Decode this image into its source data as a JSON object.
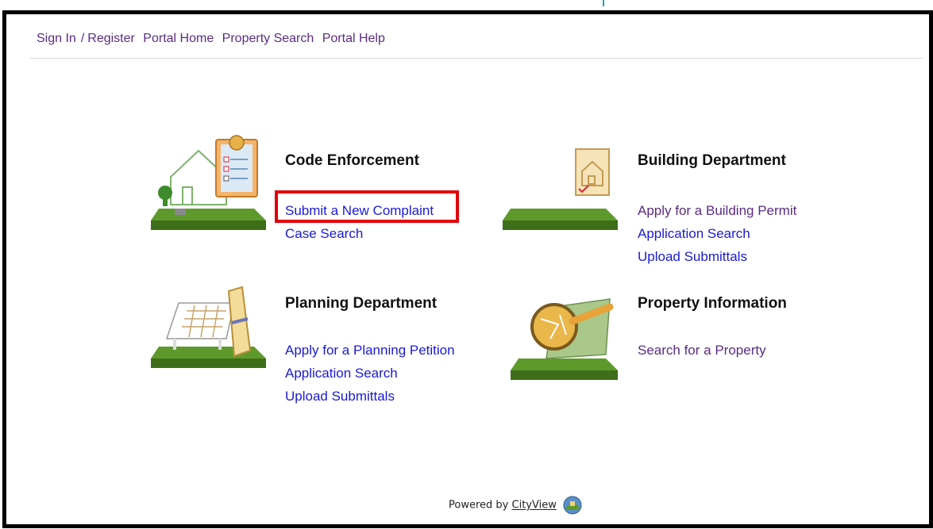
{
  "nav": {
    "sign_in": "Sign In",
    "separator": "/",
    "register": "Register",
    "portal_home": "Portal Home",
    "property_search": "Property Search",
    "portal_help": "Portal Help"
  },
  "sections": {
    "code_enforcement": {
      "title": "Code Enforcement",
      "links": [
        "Submit a New Complaint",
        "Case Search"
      ]
    },
    "building": {
      "title": "Building Department",
      "links": [
        "Apply for a Building Permit",
        "Application Search",
        "Upload Submittals"
      ]
    },
    "planning": {
      "title": "Planning Department",
      "links": [
        "Apply for a Planning Petition",
        "Application Search",
        "Upload Submittals"
      ]
    },
    "property": {
      "title": "Property Information",
      "links": [
        "Search for a Property"
      ]
    }
  },
  "footer": {
    "powered_by": "Powered by",
    "brand": "CityView"
  },
  "colors": {
    "visited_link": "#5b2b84",
    "link": "#1a1ad6",
    "highlight": "#e0000b",
    "grass": "#5e9a2b"
  }
}
